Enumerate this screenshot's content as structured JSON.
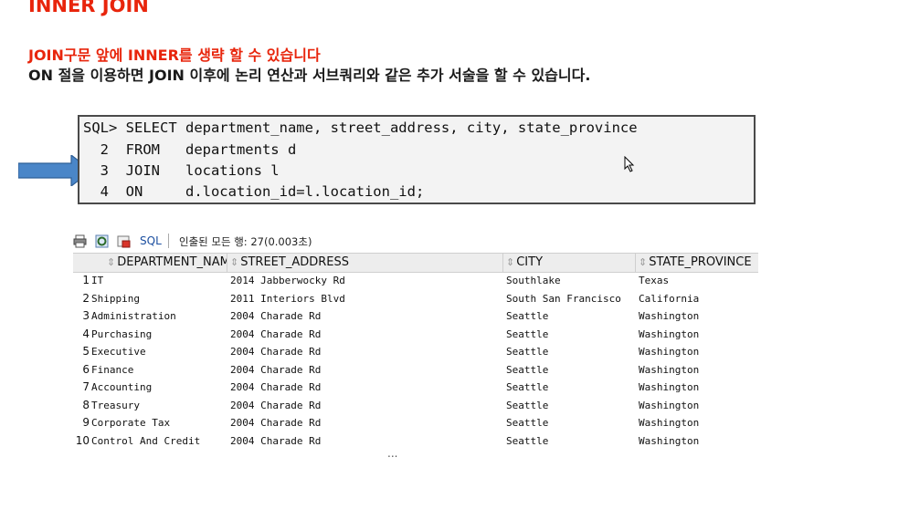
{
  "heading": {
    "title": "INNER JOIN",
    "line1": "JOIN구문 앞에 INNER를 생략 할 수 있습니다",
    "line2": "ON 절을 이용하면 JOIN 이후에 논리 연산과 서브쿼리와 같은 추가 서술을 할 수 있습니다."
  },
  "sql": {
    "lines": [
      "SQL> SELECT department_name, street_address, city, state_province",
      "  2  FROM   departments d",
      "  3  JOIN   locations l",
      "  4  ON     d.location_id=l.location_id;"
    ]
  },
  "toolbar": {
    "sql_label": "SQL",
    "fetch_status": "인출된 모든 행: 27(0.003초)"
  },
  "grid": {
    "columns": [
      "DEPARTMENT_NAME",
      "STREET_ADDRESS",
      "CITY",
      "STATE_PROVINCE"
    ],
    "rows": [
      {
        "n": "1",
        "dept": "IT",
        "street": "2014 Jabberwocky Rd",
        "city": "Southlake",
        "state": "Texas"
      },
      {
        "n": "2",
        "dept": "Shipping",
        "street": "2011 Interiors Blvd",
        "city": "South San Francisco",
        "state": "California"
      },
      {
        "n": "3",
        "dept": "Administration",
        "street": "2004 Charade Rd",
        "city": "Seattle",
        "state": "Washington"
      },
      {
        "n": "4",
        "dept": "Purchasing",
        "street": "2004 Charade Rd",
        "city": "Seattle",
        "state": "Washington"
      },
      {
        "n": "5",
        "dept": "Executive",
        "street": "2004 Charade Rd",
        "city": "Seattle",
        "state": "Washington"
      },
      {
        "n": "6",
        "dept": "Finance",
        "street": "2004 Charade Rd",
        "city": "Seattle",
        "state": "Washington"
      },
      {
        "n": "7",
        "dept": "Accounting",
        "street": "2004 Charade Rd",
        "city": "Seattle",
        "state": "Washington"
      },
      {
        "n": "8",
        "dept": "Treasury",
        "street": "2004 Charade Rd",
        "city": "Seattle",
        "state": "Washington"
      },
      {
        "n": "9",
        "dept": "Corporate Tax",
        "street": "2004 Charade Rd",
        "city": "Seattle",
        "state": "Washington"
      },
      {
        "n": "10",
        "dept": "Control And Credit",
        "street": "2004 Charade Rd",
        "city": "Seattle",
        "state": "Washington"
      }
    ],
    "more_indicator": "..."
  },
  "colors": {
    "accent_red": "#e8250c",
    "arrow_blue": "#4a86c8",
    "sql_link": "#1c4fa0"
  },
  "icons": [
    "arrow-right-icon",
    "mouse-cursor-icon",
    "print-icon",
    "refresh-icon",
    "sql-icon",
    "sort-icon"
  ]
}
